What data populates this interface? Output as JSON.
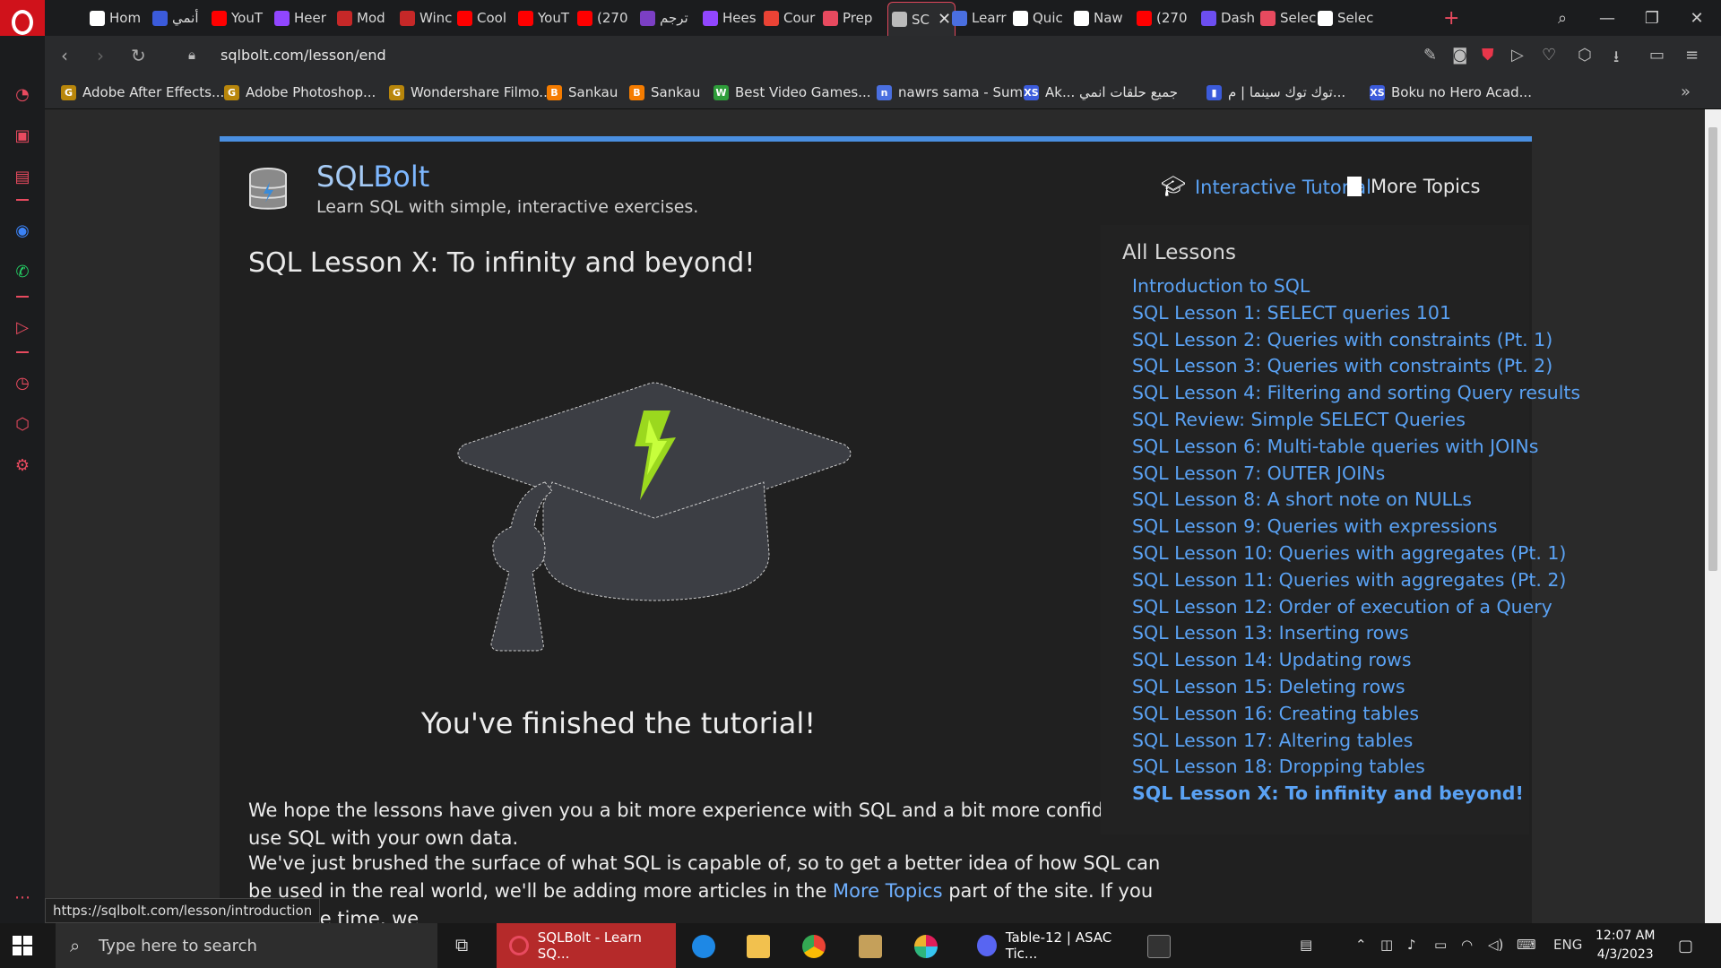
{
  "browser": {
    "tabs": [
      {
        "label": "Hom",
        "color": "#ffffff"
      },
      {
        "label": "أنمي",
        "color": "#3b5bdb"
      },
      {
        "label": "YouT",
        "color": "#ff0000"
      },
      {
        "label": "Heer",
        "color": "#9146ff"
      },
      {
        "label": "Mod",
        "color": "#c62828"
      },
      {
        "label": "Winc",
        "color": "#c62828"
      },
      {
        "label": "Cool",
        "color": "#ff0000"
      },
      {
        "label": "YouT",
        "color": "#ff0000"
      },
      {
        "label": "(270",
        "color": "#ff0000"
      },
      {
        "label": "ترجم",
        "color": "#7b3fc4"
      },
      {
        "label": "Hees",
        "color": "#9146ff"
      },
      {
        "label": "Cour",
        "color": "#ea4335"
      },
      {
        "label": "Prep",
        "color": "#e84a5f"
      },
      {
        "label": "SC",
        "color": "#bbbbbb"
      },
      {
        "label": "Learr",
        "color": "#4a6fe0"
      },
      {
        "label": "Quic",
        "color": "#ffffff"
      },
      {
        "label": "Naw",
        "color": "#ffffff"
      },
      {
        "label": "(270",
        "color": "#ff0000"
      },
      {
        "label": "Dash",
        "color": "#6c4ef0"
      },
      {
        "label": "Selec",
        "color": "#e84a5f"
      },
      {
        "label": "Selec",
        "color": "#ffffff"
      }
    ],
    "url": "sqlbolt.com/lesson/end",
    "bookmarks": [
      {
        "label": "Adobe After Effects...",
        "icon": "G",
        "color": "#b8860b"
      },
      {
        "label": "Adobe Photoshop...",
        "icon": "G",
        "color": "#b8860b"
      },
      {
        "label": "Wondershare Filmo...",
        "icon": "G",
        "color": "#b8860b"
      },
      {
        "label": "Sankau",
        "icon": "B",
        "color": "#f57c00"
      },
      {
        "label": "Sankau",
        "icon": "B",
        "color": "#f57c00"
      },
      {
        "label": "Best Video Games...",
        "icon": "W",
        "color": "#2e9d3a"
      },
      {
        "label": "nawrs sama - Sum...",
        "icon": "n",
        "color": "#4a6fe0"
      },
      {
        "label": "Ak... جميع حلقات انمي",
        "icon": "XS",
        "color": "#3b5bdb"
      },
      {
        "label": "توك توك سينما | م...",
        "icon": "▮",
        "color": "#3b5bdb"
      },
      {
        "label": "Boku no Hero Acad...",
        "icon": "XS",
        "color": "#3b5bdb"
      }
    ],
    "status_url": "https://sqlbolt.com/lesson/introduction"
  },
  "site": {
    "brand_sql": "SQL",
    "brand_bolt": "Bolt",
    "tagline": "Learn SQL with simple, interactive exercises.",
    "nav_tutorial": "Interactive Tutorial",
    "nav_more": "More Topics",
    "lesson_title": "SQL Lesson X: To infinity and beyond!",
    "finished": "You've finished the tutorial!",
    "para1": "We hope the lessons have given you a bit more experience with SQL and a bit more confidence to use SQL with your own data.",
    "para2_a": "We've just brushed the surface of what SQL is capable of, so to get a better idea of how SQL can be used in the real world, we'll be adding more articles in the ",
    "para2_link": "More Topics",
    "para2_b": " part of the site. If you have the time, we",
    "lessons_heading": "All Lessons",
    "lessons": [
      "Introduction to SQL",
      "SQL Lesson 1: SELECT queries 101",
      "SQL Lesson 2: Queries with constraints (Pt. 1)",
      "SQL Lesson 3: Queries with constraints (Pt. 2)",
      "SQL Lesson 4: Filtering and sorting Query results",
      "SQL Review: Simple SELECT Queries",
      "SQL Lesson 6: Multi-table queries with JOINs",
      "SQL Lesson 7: OUTER JOINs",
      "SQL Lesson 8: A short note on NULLs",
      "SQL Lesson 9: Queries with expressions",
      "SQL Lesson 10: Queries with aggregates (Pt. 1)",
      "SQL Lesson 11: Queries with aggregates (Pt. 2)",
      "SQL Lesson 12: Order of execution of a Query",
      "SQL Lesson 13: Inserting rows",
      "SQL Lesson 14: Updating rows",
      "SQL Lesson 15: Deleting rows",
      "SQL Lesson 16: Creating tables",
      "SQL Lesson 17: Altering tables",
      "SQL Lesson 18: Dropping tables",
      "SQL Lesson X: To infinity and beyond!"
    ],
    "current_lesson_index": 19
  },
  "taskbar": {
    "search_placeholder": "Type here to search",
    "active_app": "SQLBolt - Learn SQ...",
    "discord_app": "Table-12 | ASAC Tic...",
    "language": "ENG",
    "time": "12:07 AM",
    "date": "4/3/2023"
  }
}
